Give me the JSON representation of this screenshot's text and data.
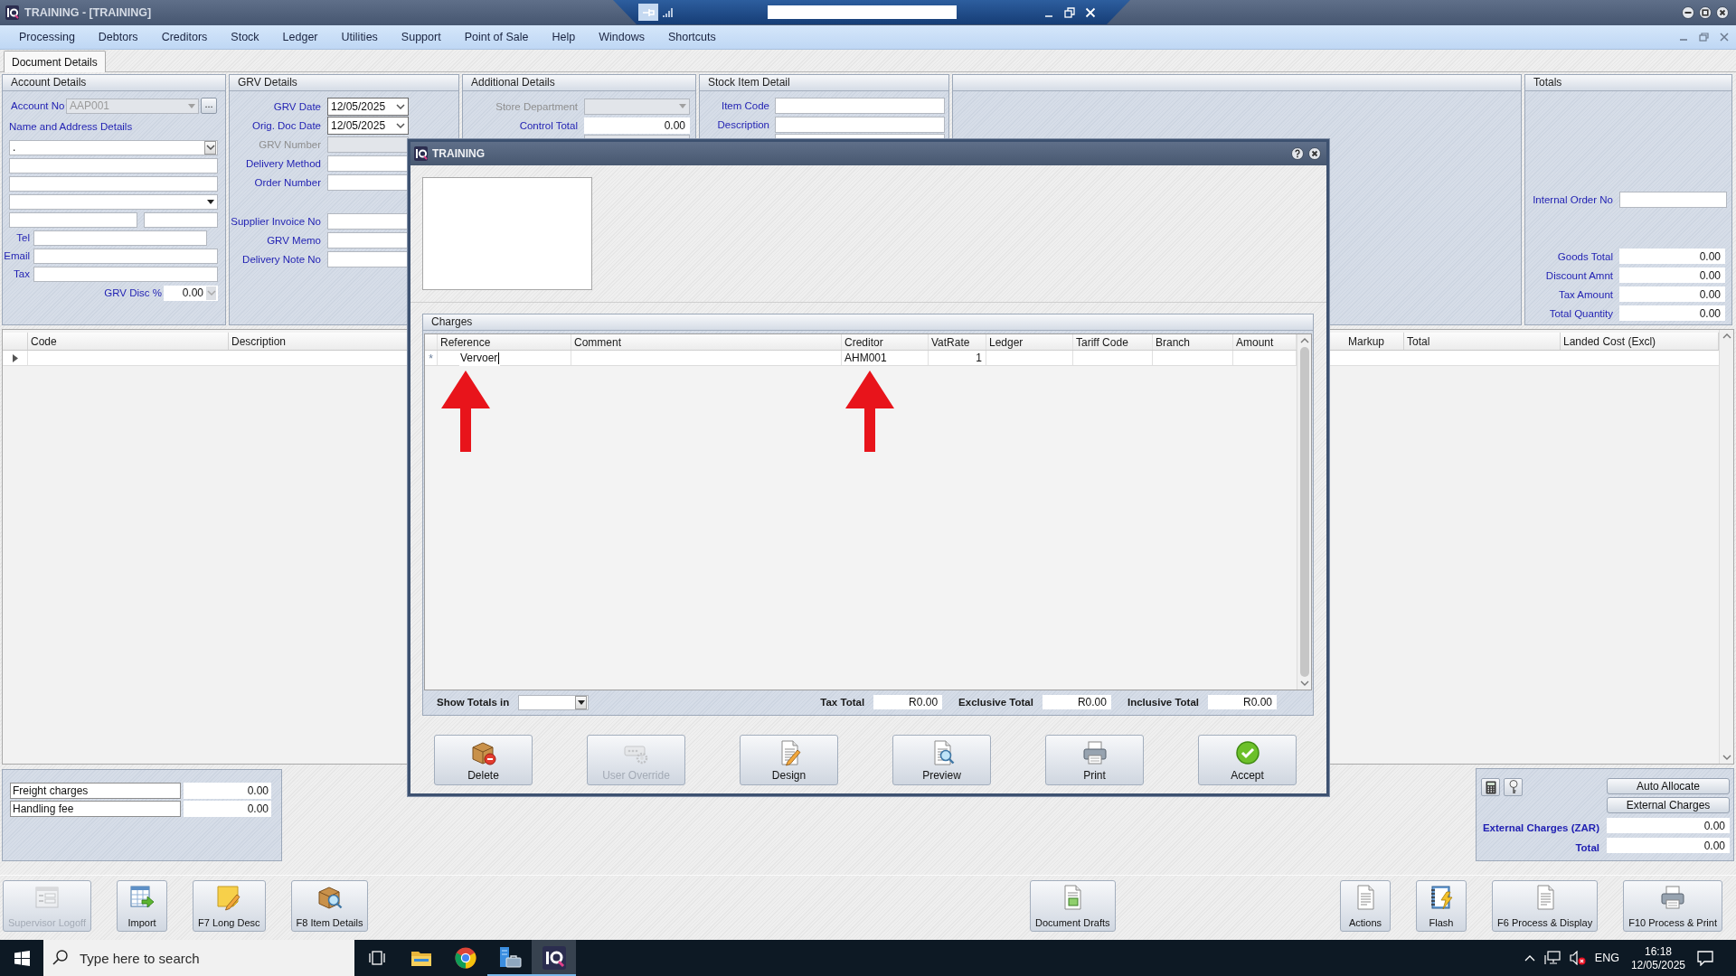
{
  "window": {
    "title": "TRAINING - [TRAINING]"
  },
  "menu": [
    "Processing",
    "Debtors",
    "Creditors",
    "Stock",
    "Ledger",
    "Utilities",
    "Support",
    "Point of Sale",
    "Help",
    "Windows",
    "Shortcuts"
  ],
  "tabs": [
    {
      "label": "Document Details",
      "selected": true
    }
  ],
  "account_details": {
    "title": "Account Details",
    "rows": [
      {
        "kind": "lookup",
        "label": "Account No",
        "value": "AAP001",
        "button": "...",
        "disabled": true
      },
      {
        "kind": "heading",
        "label": "Name and Address Details"
      },
      {
        "kind": "combo",
        "value": ".",
        "disabled": false
      },
      {
        "kind": "text",
        "disabled": false
      },
      {
        "kind": "text",
        "disabled": false
      },
      {
        "kind": "dropdown",
        "disabled": false
      },
      {
        "kind": "pair",
        "disabled": false
      },
      {
        "kind": "short",
        "label": "Tel",
        "disabled": false
      },
      {
        "kind": "labeled",
        "label": "Email",
        "disabled": false
      },
      {
        "kind": "labeled",
        "label": "Tax",
        "disabled": false
      },
      {
        "kind": "spin",
        "label": "GRV Disc %",
        "value": "0.00",
        "disabled": false
      }
    ]
  },
  "grv_details": {
    "title": "GRV Details",
    "sections": [
      {
        "rows": [
          {
            "kind": "date",
            "label": "GRV Date",
            "value": "12/05/2025",
            "disabled": false
          },
          {
            "kind": "date",
            "label": "Orig. Doc Date",
            "value": "12/05/2025",
            "disabled": false
          },
          {
            "kind": "text",
            "label": "GRV Number",
            "disabled": true
          },
          {
            "kind": "text",
            "label": "Delivery Method",
            "disabled": false
          },
          {
            "kind": "text",
            "label": "Order Number",
            "disabled": false
          }
        ]
      },
      {
        "rows": [
          {
            "kind": "text",
            "label": "Supplier Invoice No",
            "disabled": false
          },
          {
            "kind": "text",
            "label": "GRV Memo",
            "disabled": false
          },
          {
            "kind": "text",
            "label": "Delivery Note No",
            "disabled": false
          }
        ]
      }
    ]
  },
  "additional_details": {
    "title": "Additional Details",
    "rows": [
      {
        "kind": "dropdown",
        "label": "Store Department",
        "disabled": true
      },
      {
        "kind": "number",
        "label": "Control Total",
        "value": "0.00",
        "disabled": false
      },
      {
        "kind": "partial",
        "disabled": true
      }
    ]
  },
  "stock_item_detail": {
    "title": "Stock Item Detail",
    "rows": [
      {
        "kind": "text",
        "label": "Item Code",
        "disabled": false
      },
      {
        "kind": "text",
        "label": "Description",
        "disabled": false
      },
      {
        "kind": "partial",
        "disabled": false
      }
    ]
  },
  "totals": {
    "title": "Totals",
    "internal_order": {
      "label": "Internal Order No"
    },
    "rows": [
      {
        "label": "Goods Total",
        "value": "0.00"
      },
      {
        "label": "Discount Amnt",
        "value": "0.00"
      },
      {
        "label": "Tax Amount",
        "value": "0.00"
      },
      {
        "label": "Total Quantity",
        "value": "0.00"
      }
    ]
  },
  "lines_grid": {
    "columns": [
      {
        "label": "Code"
      },
      {
        "label": "Description"
      },
      {
        "label": "Markup"
      },
      {
        "label": "Total"
      },
      {
        "label": "Landed Cost (Excl)"
      }
    ],
    "rows": [
      {
        "selected": true
      }
    ]
  },
  "charges_panel": {
    "rows": [
      {
        "label": "Freight charges",
        "value": "0.00"
      },
      {
        "label": "Handling fee",
        "value": "0.00"
      }
    ]
  },
  "external_panel": {
    "tool_buttons": [
      {
        "kind": "calculator"
      },
      {
        "kind": "key"
      }
    ],
    "buttons": [
      "Auto Allocate",
      "External Charges"
    ],
    "fields": [
      {
        "label": "External Charges (ZAR)",
        "value": "0.00"
      },
      {
        "label": "Total",
        "value": "0.00"
      }
    ]
  },
  "toolbar": {
    "left": [
      {
        "kind": "logoff",
        "label": "Supervisor Logoff",
        "disabled": true
      },
      {
        "kind": "import",
        "label": "Import",
        "disabled": false
      },
      {
        "kind": "long-desc",
        "label": "F7 Long Desc",
        "disabled": false
      },
      {
        "kind": "item-details",
        "label": "F8 Item Details",
        "disabled": false
      }
    ],
    "middle": [
      {
        "kind": "drafts",
        "label": "Document Drafts",
        "disabled": false
      }
    ],
    "right": [
      {
        "kind": "actions",
        "label": "Actions",
        "disabled": false
      },
      {
        "kind": "flash",
        "label": "Flash",
        "disabled": false
      },
      {
        "kind": "process-display",
        "label": "F6 Process & Display",
        "disabled": false
      },
      {
        "kind": "process-print",
        "label": "F10 Process & Print",
        "disabled": false
      }
    ]
  },
  "dialog": {
    "title": "TRAINING",
    "charges": {
      "title": "Charges",
      "columns": [
        {
          "label": "Reference"
        },
        {
          "label": "Comment"
        },
        {
          "label": "Creditor"
        },
        {
          "label": "VatRate"
        },
        {
          "label": "Ledger"
        },
        {
          "label": "Tariff Code"
        },
        {
          "label": "Branch"
        },
        {
          "label": "Amount"
        }
      ],
      "rows": [
        {
          "marker": "*",
          "cells": [
            {
              "text": "Vervoer",
              "editing": true
            },
            {},
            {
              "text": "AHM001",
              "editing": false
            },
            {
              "text": "1",
              "editing": false
            },
            {},
            {},
            {},
            {}
          ]
        }
      ]
    },
    "show_totals": {
      "label": "Show Totals in"
    },
    "totals": [
      {
        "label": "Tax Total",
        "value": "R0.00"
      },
      {
        "label": "Exclusive Total",
        "value": "R0.00"
      },
      {
        "label": "Inclusive Total",
        "value": "R0.00"
      }
    ],
    "buttons": [
      {
        "kind": "delete",
        "label": "Delete",
        "disabled": false
      },
      {
        "kind": "override",
        "label": "User Override",
        "disabled": true
      },
      {
        "kind": "design",
        "label": "Design",
        "disabled": false
      },
      {
        "kind": "preview",
        "label": "Preview",
        "disabled": false
      },
      {
        "kind": "print",
        "label": "Print",
        "disabled": false
      },
      {
        "kind": "accept",
        "label": "Accept",
        "disabled": false
      }
    ]
  },
  "taskbar": {
    "search": {
      "placeholder": "Type here to search"
    },
    "apps": [
      {
        "kind": "task-view",
        "running": false,
        "active": false
      },
      {
        "kind": "folder",
        "running": false,
        "active": false
      },
      {
        "kind": "browser",
        "running": false,
        "active": false
      },
      {
        "kind": "server",
        "running": true,
        "active": false
      },
      {
        "kind": "app",
        "running": true,
        "active": true
      }
    ],
    "tray": {
      "language": "ENG",
      "time": "16:18",
      "date": "12/05/2025"
    }
  }
}
